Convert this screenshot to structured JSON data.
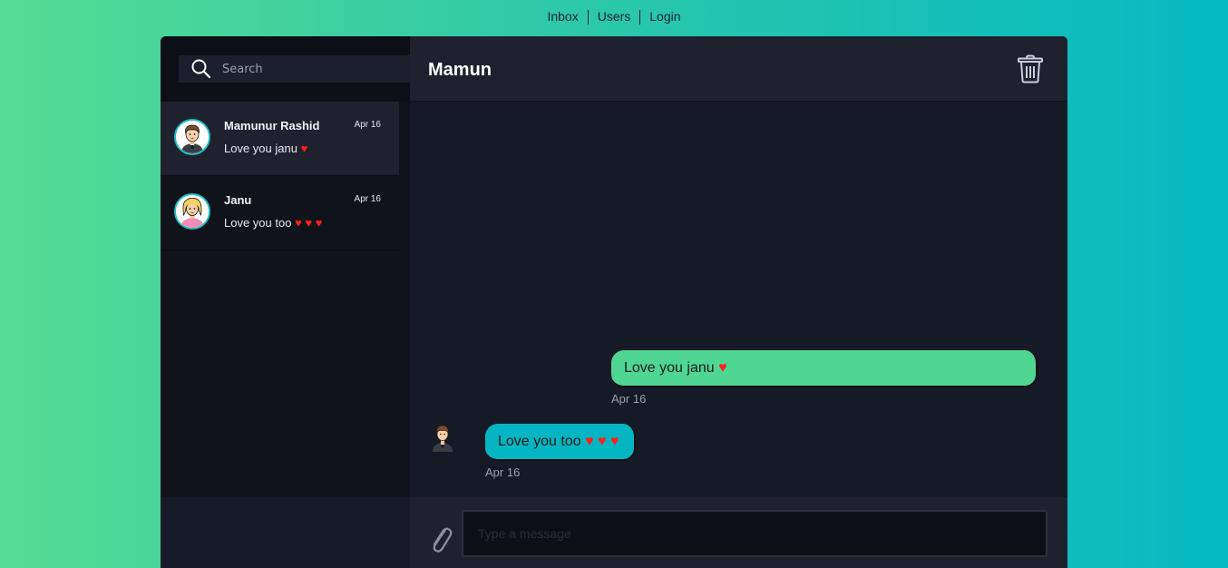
{
  "nav": {
    "links": [
      {
        "label": "Inbox"
      },
      {
        "label": "Users"
      },
      {
        "label": "Login"
      }
    ]
  },
  "sidebar": {
    "search": {
      "placeholder": "Search",
      "icon": "search-icon"
    },
    "conversations": [
      {
        "name": "Mamunur Rashid",
        "date": "Apr 16",
        "preview": "Love you janu",
        "hearts": "♥",
        "avatar": "male-avatar-icon",
        "active": true
      },
      {
        "name": "Janu",
        "date": "Apr 16",
        "preview": "Love you too",
        "hearts": "♥ ♥ ♥",
        "avatar": "female-avatar-icon",
        "active": false
      }
    ]
  },
  "chat": {
    "title": "Mamun",
    "delete_icon": "trash-icon",
    "messages": [
      {
        "text": "Love you janu",
        "hearts": "♥",
        "date": "Apr 16",
        "direction": "sent"
      },
      {
        "text": "Love you too",
        "hearts": "♥ ♥ ♥",
        "date": "Apr 16",
        "direction": "received"
      }
    ],
    "composer": {
      "placeholder": "Type a message",
      "attach_icon": "paperclip-icon"
    }
  },
  "colors": {
    "sent_bubble": "#4fd693",
    "received_bubble": "#06b5c2",
    "heart": "#ff1f1f",
    "avatar_ring": "#1dbfc4"
  }
}
